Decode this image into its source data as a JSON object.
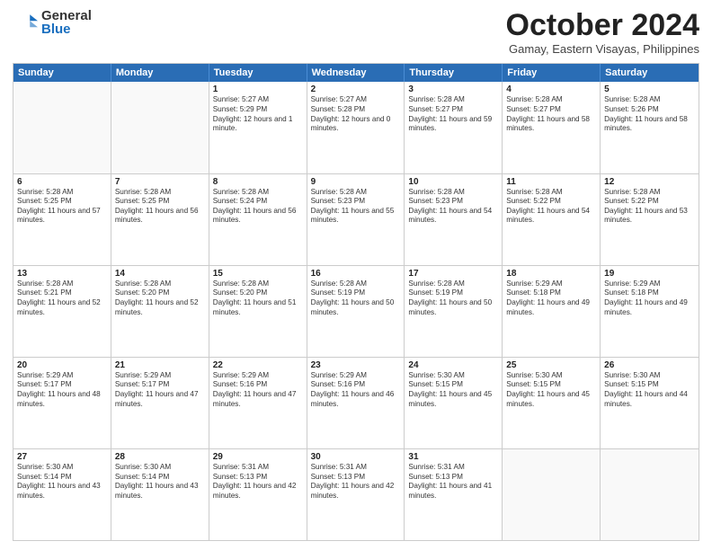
{
  "logo": {
    "general": "General",
    "blue": "Blue"
  },
  "header": {
    "month": "October 2024",
    "location": "Gamay, Eastern Visayas, Philippines"
  },
  "days": [
    "Sunday",
    "Monday",
    "Tuesday",
    "Wednesday",
    "Thursday",
    "Friday",
    "Saturday"
  ],
  "rows": [
    [
      {
        "day": "",
        "sunrise": "",
        "sunset": "",
        "daylight": ""
      },
      {
        "day": "",
        "sunrise": "",
        "sunset": "",
        "daylight": ""
      },
      {
        "day": "1",
        "sunrise": "Sunrise: 5:27 AM",
        "sunset": "Sunset: 5:29 PM",
        "daylight": "Daylight: 12 hours and 1 minute."
      },
      {
        "day": "2",
        "sunrise": "Sunrise: 5:27 AM",
        "sunset": "Sunset: 5:28 PM",
        "daylight": "Daylight: 12 hours and 0 minutes."
      },
      {
        "day": "3",
        "sunrise": "Sunrise: 5:28 AM",
        "sunset": "Sunset: 5:27 PM",
        "daylight": "Daylight: 11 hours and 59 minutes."
      },
      {
        "day": "4",
        "sunrise": "Sunrise: 5:28 AM",
        "sunset": "Sunset: 5:27 PM",
        "daylight": "Daylight: 11 hours and 58 minutes."
      },
      {
        "day": "5",
        "sunrise": "Sunrise: 5:28 AM",
        "sunset": "Sunset: 5:26 PM",
        "daylight": "Daylight: 11 hours and 58 minutes."
      }
    ],
    [
      {
        "day": "6",
        "sunrise": "Sunrise: 5:28 AM",
        "sunset": "Sunset: 5:25 PM",
        "daylight": "Daylight: 11 hours and 57 minutes."
      },
      {
        "day": "7",
        "sunrise": "Sunrise: 5:28 AM",
        "sunset": "Sunset: 5:25 PM",
        "daylight": "Daylight: 11 hours and 56 minutes."
      },
      {
        "day": "8",
        "sunrise": "Sunrise: 5:28 AM",
        "sunset": "Sunset: 5:24 PM",
        "daylight": "Daylight: 11 hours and 56 minutes."
      },
      {
        "day": "9",
        "sunrise": "Sunrise: 5:28 AM",
        "sunset": "Sunset: 5:23 PM",
        "daylight": "Daylight: 11 hours and 55 minutes."
      },
      {
        "day": "10",
        "sunrise": "Sunrise: 5:28 AM",
        "sunset": "Sunset: 5:23 PM",
        "daylight": "Daylight: 11 hours and 54 minutes."
      },
      {
        "day": "11",
        "sunrise": "Sunrise: 5:28 AM",
        "sunset": "Sunset: 5:22 PM",
        "daylight": "Daylight: 11 hours and 54 minutes."
      },
      {
        "day": "12",
        "sunrise": "Sunrise: 5:28 AM",
        "sunset": "Sunset: 5:22 PM",
        "daylight": "Daylight: 11 hours and 53 minutes."
      }
    ],
    [
      {
        "day": "13",
        "sunrise": "Sunrise: 5:28 AM",
        "sunset": "Sunset: 5:21 PM",
        "daylight": "Daylight: 11 hours and 52 minutes."
      },
      {
        "day": "14",
        "sunrise": "Sunrise: 5:28 AM",
        "sunset": "Sunset: 5:20 PM",
        "daylight": "Daylight: 11 hours and 52 minutes."
      },
      {
        "day": "15",
        "sunrise": "Sunrise: 5:28 AM",
        "sunset": "Sunset: 5:20 PM",
        "daylight": "Daylight: 11 hours and 51 minutes."
      },
      {
        "day": "16",
        "sunrise": "Sunrise: 5:28 AM",
        "sunset": "Sunset: 5:19 PM",
        "daylight": "Daylight: 11 hours and 50 minutes."
      },
      {
        "day": "17",
        "sunrise": "Sunrise: 5:28 AM",
        "sunset": "Sunset: 5:19 PM",
        "daylight": "Daylight: 11 hours and 50 minutes."
      },
      {
        "day": "18",
        "sunrise": "Sunrise: 5:29 AM",
        "sunset": "Sunset: 5:18 PM",
        "daylight": "Daylight: 11 hours and 49 minutes."
      },
      {
        "day": "19",
        "sunrise": "Sunrise: 5:29 AM",
        "sunset": "Sunset: 5:18 PM",
        "daylight": "Daylight: 11 hours and 49 minutes."
      }
    ],
    [
      {
        "day": "20",
        "sunrise": "Sunrise: 5:29 AM",
        "sunset": "Sunset: 5:17 PM",
        "daylight": "Daylight: 11 hours and 48 minutes."
      },
      {
        "day": "21",
        "sunrise": "Sunrise: 5:29 AM",
        "sunset": "Sunset: 5:17 PM",
        "daylight": "Daylight: 11 hours and 47 minutes."
      },
      {
        "day": "22",
        "sunrise": "Sunrise: 5:29 AM",
        "sunset": "Sunset: 5:16 PM",
        "daylight": "Daylight: 11 hours and 47 minutes."
      },
      {
        "day": "23",
        "sunrise": "Sunrise: 5:29 AM",
        "sunset": "Sunset: 5:16 PM",
        "daylight": "Daylight: 11 hours and 46 minutes."
      },
      {
        "day": "24",
        "sunrise": "Sunrise: 5:30 AM",
        "sunset": "Sunset: 5:15 PM",
        "daylight": "Daylight: 11 hours and 45 minutes."
      },
      {
        "day": "25",
        "sunrise": "Sunrise: 5:30 AM",
        "sunset": "Sunset: 5:15 PM",
        "daylight": "Daylight: 11 hours and 45 minutes."
      },
      {
        "day": "26",
        "sunrise": "Sunrise: 5:30 AM",
        "sunset": "Sunset: 5:15 PM",
        "daylight": "Daylight: 11 hours and 44 minutes."
      }
    ],
    [
      {
        "day": "27",
        "sunrise": "Sunrise: 5:30 AM",
        "sunset": "Sunset: 5:14 PM",
        "daylight": "Daylight: 11 hours and 43 minutes."
      },
      {
        "day": "28",
        "sunrise": "Sunrise: 5:30 AM",
        "sunset": "Sunset: 5:14 PM",
        "daylight": "Daylight: 11 hours and 43 minutes."
      },
      {
        "day": "29",
        "sunrise": "Sunrise: 5:31 AM",
        "sunset": "Sunset: 5:13 PM",
        "daylight": "Daylight: 11 hours and 42 minutes."
      },
      {
        "day": "30",
        "sunrise": "Sunrise: 5:31 AM",
        "sunset": "Sunset: 5:13 PM",
        "daylight": "Daylight: 11 hours and 42 minutes."
      },
      {
        "day": "31",
        "sunrise": "Sunrise: 5:31 AM",
        "sunset": "Sunset: 5:13 PM",
        "daylight": "Daylight: 11 hours and 41 minutes."
      },
      {
        "day": "",
        "sunrise": "",
        "sunset": "",
        "daylight": ""
      },
      {
        "day": "",
        "sunrise": "",
        "sunset": "",
        "daylight": ""
      }
    ]
  ]
}
